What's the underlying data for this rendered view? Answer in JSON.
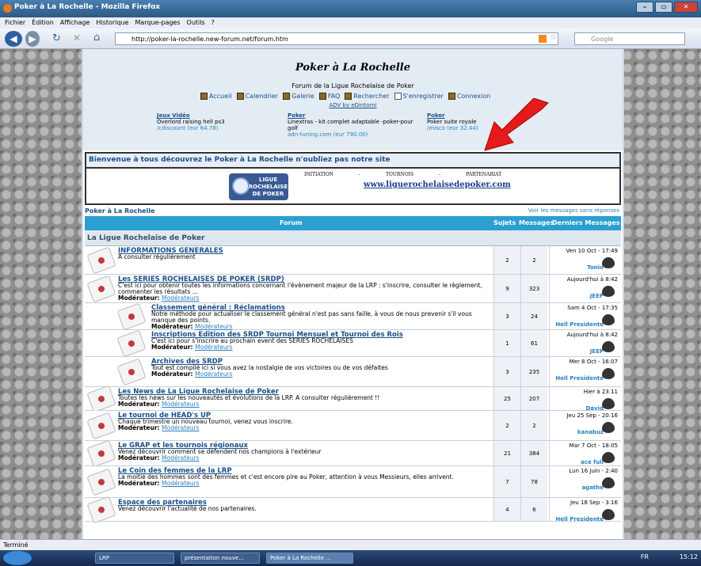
{
  "window": {
    "title": "Poker à La Rochelle - Mozilla Firefox",
    "controls": [
      "–",
      "▭",
      "✕"
    ]
  },
  "menu": [
    "Fichier",
    "Édition",
    "Affichage",
    "Historique",
    "Marque-pages",
    "Outils",
    "?"
  ],
  "navigation": {
    "url": "http://poker-la-rochelle.new-forum.net/forum.htm",
    "search_placeholder": "Google"
  },
  "site": {
    "title": "Poker à La Rochelle",
    "description": "Forum de la Ligue Rochelaise de Poker",
    "nav": [
      "Accueil",
      "Calendrier",
      "Galerie",
      "FAQ",
      "Rechercher",
      "S'enregistrer",
      "Connexion"
    ],
    "adv": "ADV by eDintorni",
    "ads": [
      {
        "title": "Jeux Vidéo",
        "text": "Overlord raising hell ps3",
        "url": "/cdiscount (eur 64.78)"
      },
      {
        "title": "Poker",
        "text": "Linextras - kit complet adaptable -poker-pour golf",
        "url": "adn-tuning.com (eur 790.00)"
      },
      {
        "title": "Poker",
        "text": "Poker suite royale",
        "url": "/misco (eur 32.44)"
      }
    ]
  },
  "welcome": "Bienvenue à tous découvrez le Poker à La Rochelle n'oubliez pas notre site",
  "banner": {
    "logo_lines": [
      "LIGUE",
      "ROCHELAISE",
      "DE POKER"
    ],
    "links": [
      "INITIATION",
      "-",
      "TOURNOIS",
      "-",
      "PARTENARIAT"
    ],
    "url": "www.liguerochelaisedepoker.com"
  },
  "breadcrumb": "Poker à La Rochelle",
  "unread": "Voir les messages sans réponses",
  "table": {
    "headers": {
      "forum": "Forum",
      "topics": "Sujets",
      "messages": "Messages",
      "last": "Derniers Messages"
    },
    "category": "La Ligue Rochelaise de Poker",
    "rows": [
      {
        "name": "INFORMATIONS GENERALES",
        "desc": "A consulter régulièrement",
        "mod": "",
        "topics": "2",
        "messages": "2",
        "date": "Ven 10 Oct - 17:49",
        "user": "Tonio",
        "sub": false
      },
      {
        "name": "Les SERIES ROCHELAISES DE POKER (SRDP)",
        "desc": "C'est ici pour obtenir toutes les informations concernant l'évènement majeur de la LRP : s'inscrire, consulter le règlement, commenter les résultats ...",
        "mod": "Modérateurs",
        "topics": "9",
        "messages": "323",
        "date": "Aujourd'hui à 8:42",
        "user": "JEEP",
        "sub": false
      },
      {
        "name": "Classement général : Réclamations",
        "desc": "Notre méthode pour actualiser le classement général n'est pas sans faille, à vous de nous prevenir s'il vous manque des points.",
        "mod": "Modérateurs",
        "topics": "3",
        "messages": "24",
        "date": "Sam 4 Oct - 17:35",
        "user": "Hell Presidente",
        "sub": true
      },
      {
        "name": "Inscriptions Edition des SRDP Tournoi Mensuel et Tournoi des Rois",
        "desc": "C'est ici pour s'inscrire au prochain event des SERIES ROCHELAISES",
        "mod": "Modérateurs",
        "topics": "1",
        "messages": "61",
        "date": "Aujourd'hui à 8:42",
        "user": "JEEP",
        "sub": true
      },
      {
        "name": "Archives des SRDP",
        "desc": "Tout est compilé ici si vous avez la nostalgie de vos victoires ou de vos défaites",
        "mod": "Modérateurs",
        "topics": "3",
        "messages": "235",
        "date": "Mer 8 Oct - 16:07",
        "user": "Hell Presidente",
        "sub": true
      },
      {
        "name": "Les News de La Ligue Rochelaise de Poker",
        "desc": "Toutes les news sur les nouveautés et évolutions de la LRP. A consulter régulièrement !!",
        "mod": "Modérateurs",
        "topics": "25",
        "messages": "207",
        "date": "Hier à 23:11",
        "user": "David",
        "sub": false
      },
      {
        "name": "Le tournoi de HEAD's UP",
        "desc": "Chaque trimestre un nouveau tournoi, venez vous inscrire.",
        "mod": "Modérateurs",
        "topics": "2",
        "messages": "2",
        "date": "Jeu 25 Sep - 20:16",
        "user": "kanabuz",
        "sub": false
      },
      {
        "name": "Le GRAP et les tournois régionaux",
        "desc": "Venez découvrir comment se défendent nos champions à l'extérieur",
        "mod": "Modérateurs",
        "topics": "21",
        "messages": "384",
        "date": "Mar 7 Oct - 18:05",
        "user": "ace full",
        "sub": false
      },
      {
        "name": "Le Coin des femmes de la LRP",
        "desc": "La moitié des hommes sont des femmes et c'est encore pire au Poker, attention à vous Messieurs, elles arrivent.",
        "mod": "Modérateurs",
        "topics": "7",
        "messages": "78",
        "date": "Lun 16 Juin - 2:40",
        "user": "agathe",
        "sub": false
      },
      {
        "name": "Espace des partenaires",
        "desc": "Venez découvrir l'actualité de nos partenaires.",
        "mod": "",
        "topics": "4",
        "messages": "6",
        "date": "Jeu 18 Sep - 3:16",
        "user": "Hell Presidente",
        "sub": false
      }
    ]
  },
  "status": "Terminé",
  "taskbar": {
    "items": [
      "LRP",
      "présentation nouve...",
      "Poker à La Rochelle ..."
    ],
    "lang": "FR",
    "clock": "15:12"
  }
}
